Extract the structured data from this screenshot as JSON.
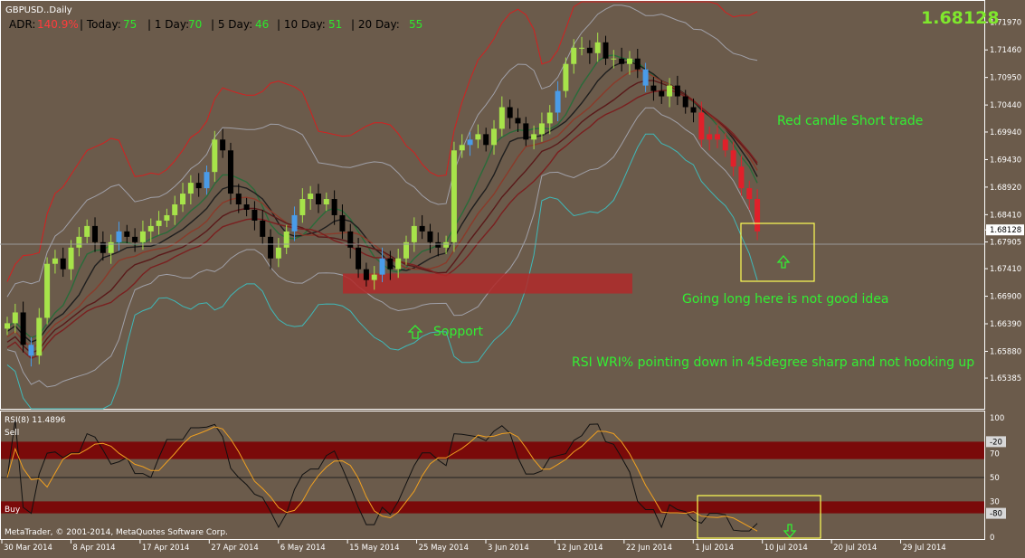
{
  "header": {
    "symbol": "GBPUSD..Daily",
    "adr_label": "ADR:",
    "adr_value": "140.9%",
    "today_label": "| Today:",
    "today_value": "75",
    "d1_label": "| 1 Day:",
    "d1_value": "70",
    "d5_label": "| 5 Day:",
    "d5_value": "46",
    "d10_label": "| 10 Day:",
    "d10_value": "51",
    "d20_label": "| 20 Day:",
    "d20_value": "55",
    "big_price": "1.68128"
  },
  "annotations": {
    "red_candle": "Red candle Short trade",
    "going_long": "Going long here is not good idea",
    "rsi_note": "RSI WRI% pointing down in 45degree sharp and not hooking up",
    "support": "Sopport"
  },
  "rsi": {
    "title": "RSI(8) 11.4896",
    "sell_label": "Sell",
    "buy_label": "Buy",
    "levels": [
      "100",
      "-20",
      "70",
      "50",
      "30",
      "-80",
      "0"
    ]
  },
  "footer": {
    "copyright": "MetaTrader, © 2001-2014, MetaQuotes Software Corp."
  },
  "colors": {
    "background": "#6b5b4b",
    "bull_candle": "#a7e34a",
    "bear_candle": "#000000",
    "blue_candle": "#4a9be8",
    "red_candle": "#e0202a",
    "annotation_text": "#33ee33",
    "zone_red": "#b02a2a",
    "highlight_box": "#ffff55",
    "rsi_band": "#7a0a0a"
  },
  "chart_data": {
    "type": "candlestick",
    "price_axis": {
      "min": 1.6485,
      "max": 1.7225,
      "ticks": [
        "1.71970",
        "1.71460",
        "1.70950",
        "1.70440",
        "1.69940",
        "1.69430",
        "1.68920",
        "1.68410",
        "1.68128",
        "1.67905",
        "1.67410",
        "1.66900",
        "1.66390",
        "1.65880",
        "1.65385"
      ]
    },
    "date_axis": [
      "30 Mar 2014",
      "8 Apr 2014",
      "17 Apr 2014",
      "27 Apr 2014",
      "6 May 2014",
      "15 May 2014",
      "25 May 2014",
      "3 Jun 2014",
      "12 Jun 2014",
      "22 Jun 2014",
      "1 Jul 2014",
      "10 Jul 2014",
      "20 Jul 2014",
      "29 Jul 2014"
    ],
    "closes": [
      1.664,
      1.666,
      1.66,
      1.658,
      1.665,
      1.675,
      1.676,
      1.674,
      1.678,
      1.68,
      1.682,
      1.679,
      1.677,
      1.679,
      1.681,
      1.68,
      1.679,
      1.681,
      1.682,
      1.683,
      1.684,
      1.686,
      1.688,
      1.69,
      1.689,
      1.692,
      1.698,
      1.696,
      1.688,
      1.686,
      1.685,
      1.683,
      1.68,
      1.676,
      1.678,
      1.681,
      1.684,
      1.687,
      1.688,
      1.686,
      1.687,
      1.684,
      1.681,
      1.678,
      1.674,
      1.672,
      1.673,
      1.676,
      1.674,
      1.676,
      1.679,
      1.682,
      1.681,
      1.679,
      1.678,
      1.679,
      1.696,
      1.697,
      1.698,
      1.699,
      1.697,
      1.7,
      1.704,
      1.702,
      1.701,
      1.698,
      1.699,
      1.701,
      1.703,
      1.707,
      1.712,
      1.715,
      1.715,
      1.714,
      1.716,
      1.713,
      1.713,
      1.712,
      1.713,
      1.711,
      1.708,
      1.707,
      1.706,
      1.708,
      1.706,
      1.704,
      1.703,
      1.698,
      1.699,
      1.698,
      1.696,
      1.693,
      1.689,
      1.687,
      1.681
    ],
    "support_zone": {
      "low": 1.6695,
      "high": 1.6732
    },
    "last_price": 1.68128,
    "rsi_overbought": 70,
    "rsi_oversold": 30,
    "rsi_last": 11.4896
  }
}
